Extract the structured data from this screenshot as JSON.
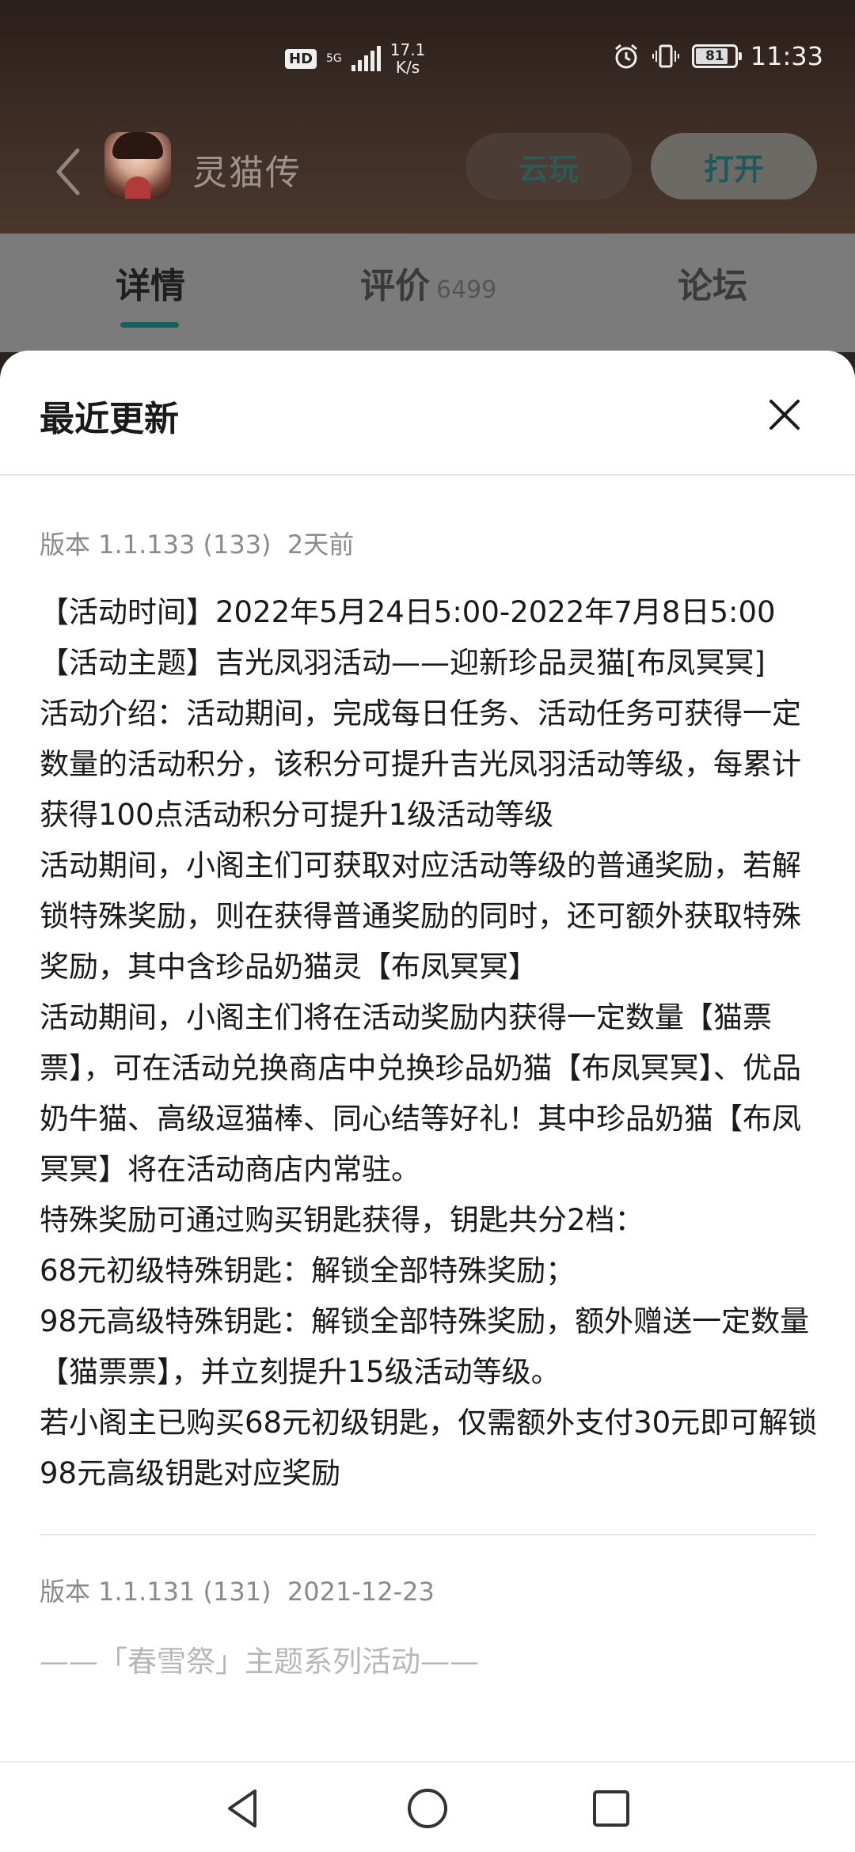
{
  "status_bar": {
    "hd": "HD",
    "network": "5G",
    "speed_value": "17.1",
    "speed_unit": "K/s",
    "battery": "81",
    "time": "11:33"
  },
  "app": {
    "name": "灵猫传",
    "cloud_play_label": "云玩",
    "open_label": "打开"
  },
  "tabs": [
    {
      "label": "详情",
      "count": ""
    },
    {
      "label": "评价",
      "count": "6499"
    },
    {
      "label": "论坛",
      "count": ""
    }
  ],
  "sheet": {
    "title": "最近更新",
    "versions": [
      {
        "version": "版本 1.1.133 (133)",
        "date": "2天前",
        "notes": [
          "【活动时间】2022年5月24日5:00-2022年7月8日5:00",
          "【活动主题】吉光凤羽活动——迎新珍品灵猫[布凤冥冥]",
          "活动介绍：活动期间，完成每日任务、活动任务可获得一定数量的活动积分，该积分可提升吉光凤羽活动等级，每累计获得100点活动积分可提升1级活动等级",
          "活动期间，小阁主们可获取对应活动等级的普通奖励，若解锁特殊奖励，则在获得普通奖励的同时，还可额外获取特殊奖励，其中含珍品奶猫灵【布凤冥冥】",
          "活动期间，小阁主们将在活动奖励内获得一定数量【猫票票】，可在活动兑换商店中兑换珍品奶猫【布凤冥冥】、优品奶牛猫、高级逗猫棒、同心结等好礼！其中珍品奶猫【布凤冥冥】将在活动商店内常驻。",
          "特殊奖励可通过购买钥匙获得，钥匙共分2档：",
          "68元初级特殊钥匙：解锁全部特殊奖励；",
          "98元高级特殊钥匙：解锁全部特殊奖励，额外赠送一定数量【猫票票】，并立刻提升15级活动等级。",
          "若小阁主已购买68元初级钥匙，仅需额外支付30元即可解锁98元高级钥匙对应奖励"
        ]
      },
      {
        "version": "版本 1.1.131 (131)",
        "date": "2021-12-23",
        "notes": [
          "——「春雪祭」主题系列活动——"
        ]
      }
    ]
  }
}
